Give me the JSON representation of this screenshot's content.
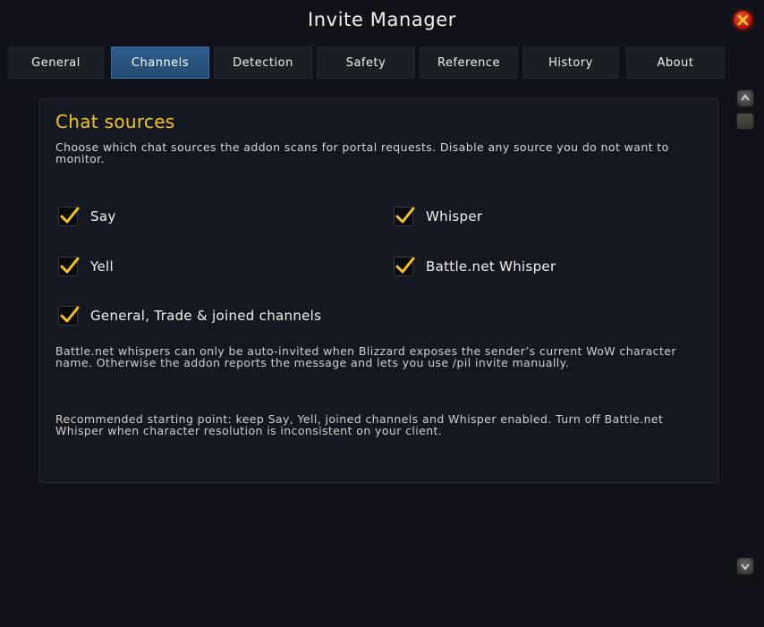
{
  "window": {
    "title": "Invite Manager"
  },
  "tabs": [
    {
      "label": "General",
      "active": false
    },
    {
      "label": "Channels",
      "active": true
    },
    {
      "label": "Detection",
      "active": false
    },
    {
      "label": "Safety",
      "active": false
    },
    {
      "label": "Reference",
      "active": false
    },
    {
      "label": "History",
      "active": false
    },
    {
      "label": "About",
      "active": false
    }
  ],
  "panel": {
    "title": "Chat sources",
    "description": "Choose which chat sources the addon scans for portal requests. Disable any source you do not want to monitor.",
    "options": [
      {
        "label": "Say",
        "checked": true
      },
      {
        "label": "Whisper",
        "checked": true
      },
      {
        "label": "Yell",
        "checked": true
      },
      {
        "label": "Battle.net Whisper",
        "checked": true
      },
      {
        "label": "General, Trade & joined channels",
        "checked": true
      }
    ],
    "note_bnet": "Battle.net whispers can only be auto-invited when Blizzard exposes the sender’s current WoW character name. Otherwise the addon reports the message and lets you use /pil invite manually.",
    "note_recommended": "Recommended starting point: keep Say, Yell, joined channels and Whisper enabled. Turn off Battle.net Whisper when character resolution is inconsistent on your client."
  },
  "colors": {
    "accent_title": "#f5c518",
    "tab_active": "#2d5c8a",
    "close_red": "#c2190f",
    "check_yellow": "#f5c518"
  },
  "icons": {
    "close": "close-icon",
    "check": "checkmark-icon",
    "scroll_up": "arrow-up-icon",
    "scroll_down": "arrow-down-icon"
  }
}
